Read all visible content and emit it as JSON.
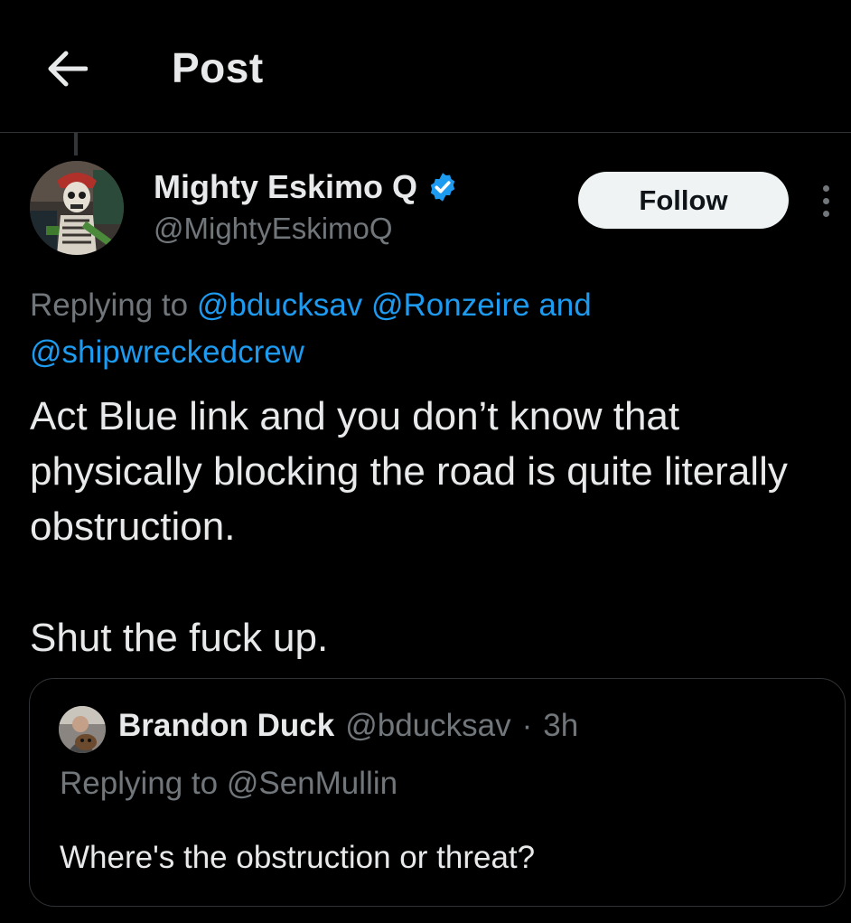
{
  "header": {
    "title": "Post",
    "back_icon": "arrow-left-icon"
  },
  "post": {
    "author": {
      "name": "Mighty Eskimo Q",
      "handle": "@MightyEskimoQ",
      "verified_icon": "verified-badge-icon",
      "verified_color": "#1d9bf0"
    },
    "follow_label": "Follow",
    "more_icon": "more-vertical-icon",
    "replying_prefix": "Replying to",
    "replying_mentions": [
      "@bducksav",
      "@Ronzeire"
    ],
    "replying_and": "and",
    "replying_last": "@shipwreckedcrew",
    "text": "Act Blue link and you don’t know that physically blocking the road is quite literally obstruction.",
    "text2": "Shut the fuck up."
  },
  "quote": {
    "name": "Brandon Duck",
    "handle": "@bducksav",
    "separator": "·",
    "time": "3h",
    "replying_prefix": "Replying to",
    "replying_mention": "@SenMullin",
    "text": "Where's the obstruction or threat?"
  },
  "colors": {
    "background": "#000000",
    "text": "#e7e9ea",
    "muted": "#71767b",
    "link": "#1d9bf0",
    "border": "#2f3336",
    "follow_bg": "#eff3f4"
  }
}
